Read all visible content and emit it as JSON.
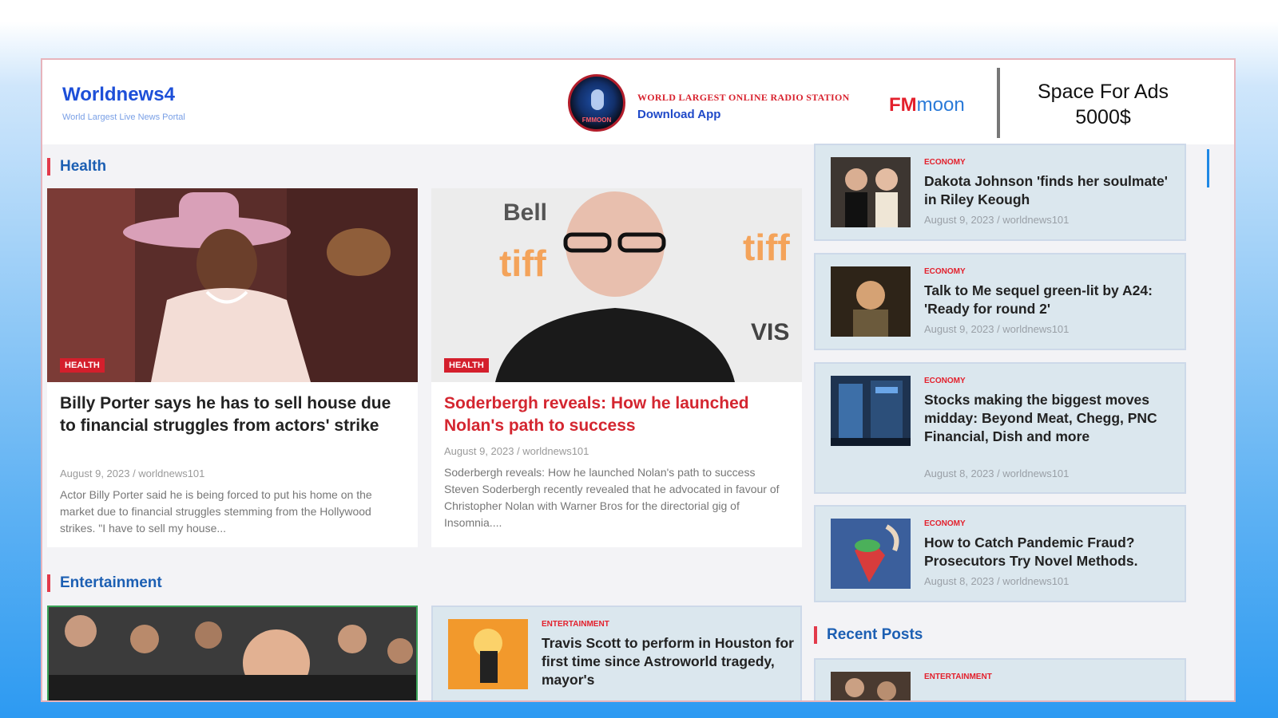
{
  "header": {
    "site_title": "Worldnews4",
    "site_tagline": "World Largest Live News Portal",
    "radio_mini": "FMMOON",
    "radio_line1": "WORLD LARGEST ONLINE RADIO STATION",
    "radio_line2": "Download App",
    "fm": "FM",
    "moon": "moon",
    "ad_line1": "Space For Ads",
    "ad_line2": "5000$"
  },
  "sections": {
    "health": "Health",
    "entertainment": "Entertainment",
    "recent": "Recent Posts"
  },
  "health_cards": [
    {
      "badge": "HEALTH",
      "title": "Billy Porter says he has to sell house due to financial struggles from actors' strike",
      "meta": "August 9, 2023 / worldnews101",
      "excerpt": "Actor Billy Porter said he is being forced to put his home on the market due to financial struggles stemming from the Hollywood strikes. \"I have to sell my house..."
    },
    {
      "badge": "HEALTH",
      "title": "Soderbergh reveals: How he launched Nolan's path to success",
      "meta": "August 9, 2023 / worldnews101",
      "excerpt": "Soderbergh reveals: How he launched Nolan's path to success Steven Soderbergh recently revealed that he advocated in favour of Christopher Nolan with Warner Bros for the directorial gig of Insomnia...."
    }
  ],
  "entertainment_card": {
    "cat": "ENTERTAINMENT",
    "title": "Travis Scott to perform in Houston for first time since Astroworld tragedy, mayor's"
  },
  "sidebar": [
    {
      "cat": "ECONOMY",
      "title": "Dakota Johnson 'finds her soulmate' in Riley Keough",
      "meta": "August 9, 2023 / worldnews101"
    },
    {
      "cat": "ECONOMY",
      "title": "Talk to Me sequel green-lit by A24: 'Ready for round 2'",
      "meta": "August 9, 2023 / worldnews101"
    },
    {
      "cat": "ECONOMY",
      "title": "Stocks making the biggest moves midday: Beyond Meat, Chegg, PNC Financial, Dish and more",
      "meta": "August 8, 2023 / worldnews101"
    },
    {
      "cat": "ECONOMY",
      "title": "How to Catch Pandemic Fraud? Prosecutors Try Novel Methods.",
      "meta": "August 8, 2023 / worldnews101"
    }
  ],
  "recent": {
    "cat": "ENTERTAINMENT"
  },
  "colors": {
    "accent_red": "#e3202c",
    "link_blue": "#1c5fb3",
    "card_bg": "#dbe7ee"
  }
}
